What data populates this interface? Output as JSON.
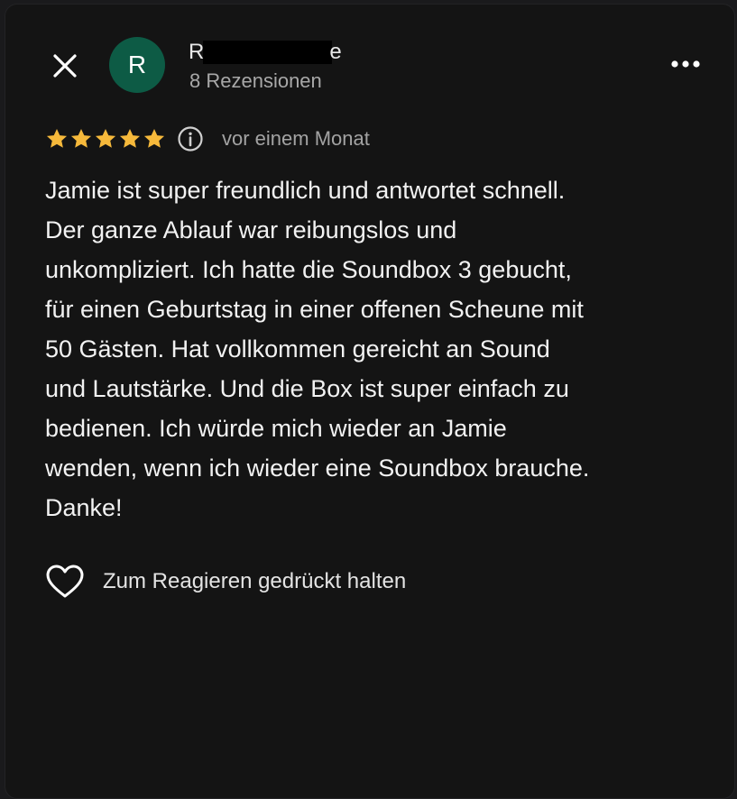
{
  "header": {
    "close_icon": "close-icon",
    "avatar_initial": "R",
    "avatar_color": "#0d5b45",
    "author_name_start": "R",
    "author_name_end": "e",
    "review_count": "8 Rezensionen",
    "more_icon": "more-horizontal-icon"
  },
  "rating": {
    "stars": 5,
    "max_stars": 5,
    "star_color": "#f6b93b",
    "info_icon": "info-icon",
    "date": "vor einem Monat"
  },
  "review": {
    "text": "Jamie ist super freundlich und antwortet schnell.\nDer ganze Ablauf war reibungslos und\nunkompliziert. Ich hatte die Soundbox 3 gebucht,\nfür einen Geburtstag in einer offenen Scheune mit\n50 Gästen. Hat vollkommen gereicht an Sound\nund Lautstärke. Und die Box ist super einfach zu\nbedienen. Ich würde mich wieder an Jamie\nwenden, wenn ich wieder eine Soundbox brauche.\nDanke!"
  },
  "reaction": {
    "icon": "heart-icon",
    "label": "Zum Reagieren gedrückt halten"
  }
}
